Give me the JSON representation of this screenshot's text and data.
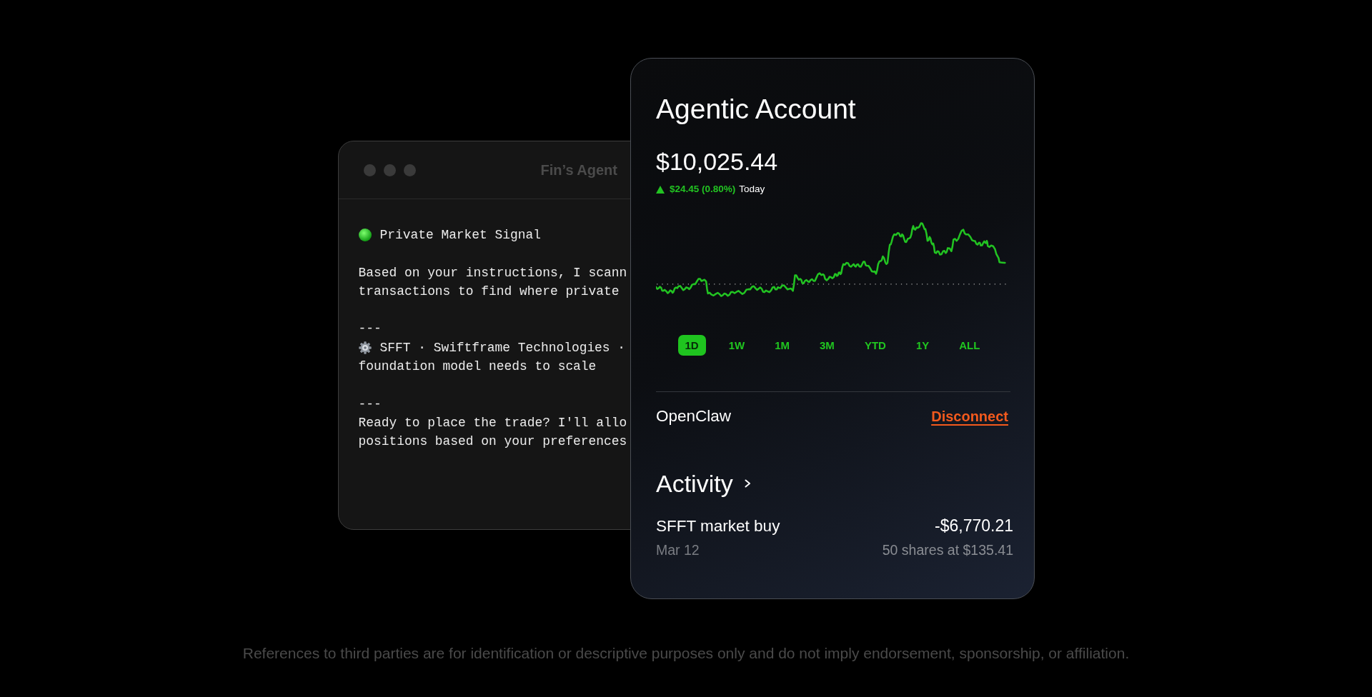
{
  "agent_window": {
    "title": "Fin’s Agent",
    "messages": [
      {
        "kind": "status",
        "text": "Private Market Signal"
      },
      {
        "kind": "paragraph",
        "lines": [
          "Based on your instructions, I scann",
          "transactions to find where private"
        ]
      },
      {
        "kind": "rule",
        "text": "---"
      },
      {
        "kind": "company",
        "lines": [
          "SFFT · Swiftframe Technologies ·",
          "foundation model needs to scale"
        ]
      },
      {
        "kind": "rule",
        "text": "---"
      },
      {
        "kind": "paragraph",
        "lines": [
          "Ready to place the trade? I'll allo",
          "positions based on your preferences"
        ]
      }
    ]
  },
  "account_card": {
    "title": "Agentic Account",
    "balance": "$10,025.44",
    "change": {
      "gain": true,
      "amount": "$24.45 (0.80%)",
      "period": "Today"
    },
    "ranges": [
      {
        "label": "1D",
        "selected": true
      },
      {
        "label": "1W",
        "selected": false
      },
      {
        "label": "1M",
        "selected": false
      },
      {
        "label": "3M",
        "selected": false
      },
      {
        "label": "YTD",
        "selected": false
      },
      {
        "label": "1Y",
        "selected": false
      },
      {
        "label": "ALL",
        "selected": false
      }
    ],
    "connection": {
      "name": "OpenClaw",
      "action": "Disconnect"
    },
    "activity": {
      "title": "Activity",
      "items": [
        {
          "title": "SFFT market buy",
          "amount": "-$6,770.21",
          "date": "Mar 12",
          "detail": "50 shares at $135.41"
        }
      ]
    }
  },
  "disclaimer": "References to third parties are for identification or descriptive purposes only and do not imply endorsement, sponsorship, or affiliation."
}
